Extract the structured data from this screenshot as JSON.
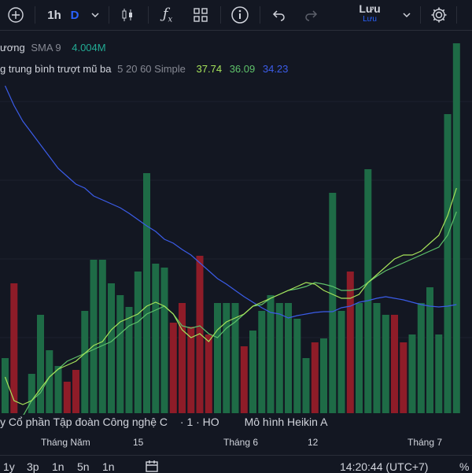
{
  "toolbar": {
    "interval": "1h",
    "interval_d": "D",
    "save_label": "Lưu",
    "save_sub": "Lưu",
    "icons": [
      "plus-icon",
      "chevron-down-icon",
      "candles-icon",
      "fx-icon",
      "grid-icon",
      "info-icon",
      "undo-icon",
      "redo-icon",
      "gear-icon"
    ]
  },
  "legend": {
    "volume_name": "ương",
    "volume_ma": "SMA 9",
    "volume_value": "4.004M",
    "ema_name": "g trung bình trượt mũ ba",
    "ema_params": "5 20 60 Simple",
    "ema_values": [
      "37.74",
      "36.09",
      "34.23"
    ],
    "colors": {
      "green": "#5ec26a",
      "lime": "#a6e35a",
      "blue": "#3b5ce8"
    }
  },
  "bottom": {
    "name_part1": "y Cổ phần Tập đoàn Công nghệ C",
    "name_part2": "· 1 · HO",
    "name_part3": "Mô hình Heikin A"
  },
  "xaxis": {
    "labels": [
      "Tháng Năm",
      "15",
      "Tháng 6",
      "12",
      "Tháng 7"
    ]
  },
  "footer": {
    "ranges": [
      "1y",
      "3p",
      "1n",
      "5n",
      "1n"
    ],
    "time": "14:20:44 (UTC+7)",
    "percent": "%"
  },
  "chart_data": {
    "type": "bar",
    "title": "",
    "bars": [
      {
        "v": 70,
        "c": "g"
      },
      {
        "v": 165,
        "c": "r"
      },
      {
        "v": 0,
        "c": "g"
      },
      {
        "v": 50,
        "c": "g"
      },
      {
        "v": 125,
        "c": "g"
      },
      {
        "v": 80,
        "c": "g"
      },
      {
        "v": 60,
        "c": "g"
      },
      {
        "v": 40,
        "c": "r"
      },
      {
        "v": 55,
        "c": "r"
      },
      {
        "v": 130,
        "c": "g"
      },
      {
        "v": 195,
        "c": "g"
      },
      {
        "v": 195,
        "c": "g"
      },
      {
        "v": 165,
        "c": "g"
      },
      {
        "v": 150,
        "c": "g"
      },
      {
        "v": 135,
        "c": "g"
      },
      {
        "v": 180,
        "c": "g"
      },
      {
        "v": 305,
        "c": "g"
      },
      {
        "v": 190,
        "c": "g"
      },
      {
        "v": 185,
        "c": "g"
      },
      {
        "v": 115,
        "c": "r"
      },
      {
        "v": 140,
        "c": "r"
      },
      {
        "v": 110,
        "c": "r"
      },
      {
        "v": 200,
        "c": "r"
      },
      {
        "v": 100,
        "c": "r"
      },
      {
        "v": 140,
        "c": "g"
      },
      {
        "v": 140,
        "c": "g"
      },
      {
        "v": 140,
        "c": "g"
      },
      {
        "v": 85,
        "c": "r"
      },
      {
        "v": 105,
        "c": "g"
      },
      {
        "v": 130,
        "c": "g"
      },
      {
        "v": 150,
        "c": "g"
      },
      {
        "v": 140,
        "c": "g"
      },
      {
        "v": 140,
        "c": "g"
      },
      {
        "v": 120,
        "c": "g"
      },
      {
        "v": 70,
        "c": "g"
      },
      {
        "v": 90,
        "c": "r"
      },
      {
        "v": 95,
        "c": "g"
      },
      {
        "v": 280,
        "c": "g"
      },
      {
        "v": 130,
        "c": "g"
      },
      {
        "v": 180,
        "c": "r"
      },
      {
        "v": 140,
        "c": "g"
      },
      {
        "v": 310,
        "c": "g"
      },
      {
        "v": 140,
        "c": "g"
      },
      {
        "v": 125,
        "c": "g"
      },
      {
        "v": 125,
        "c": "r"
      },
      {
        "v": 90,
        "c": "r"
      },
      {
        "v": 100,
        "c": "g"
      },
      {
        "v": 140,
        "c": "g"
      },
      {
        "v": 160,
        "c": "g"
      },
      {
        "v": 100,
        "c": "g"
      },
      {
        "v": 380,
        "c": "g"
      },
      {
        "v": 470,
        "c": "g"
      }
    ],
    "sma_short": [
      440,
      470,
      475,
      470,
      455,
      440,
      430,
      425,
      420,
      410,
      400,
      395,
      380,
      370,
      365,
      360,
      350,
      345,
      350,
      360,
      380,
      390,
      385,
      395,
      380,
      370,
      365,
      360,
      350,
      345,
      340,
      335,
      330,
      325,
      320,
      322,
      330,
      335,
      340,
      340,
      335,
      320,
      310,
      300,
      290,
      285,
      285,
      280,
      270,
      260,
      235,
      200
    ],
    "sma_mid": [
      505,
      500,
      490,
      470,
      460,
      440,
      430,
      420,
      415,
      410,
      405,
      400,
      395,
      385,
      375,
      370,
      360,
      355,
      350,
      360,
      375,
      378,
      375,
      385,
      390,
      378,
      370,
      360,
      350,
      348,
      340,
      335,
      330,
      328,
      325,
      320,
      322,
      325,
      330,
      330,
      328,
      320,
      312,
      305,
      300,
      295,
      290,
      285,
      280,
      275,
      260,
      230
    ],
    "sma_long": [
      70,
      95,
      115,
      130,
      145,
      160,
      175,
      185,
      195,
      200,
      210,
      215,
      220,
      225,
      232,
      240,
      248,
      255,
      265,
      270,
      278,
      285,
      295,
      305,
      315,
      322,
      330,
      338,
      345,
      352,
      358,
      360,
      365,
      362,
      360,
      358,
      357,
      357,
      352,
      350,
      345,
      343,
      340,
      338,
      340,
      342,
      345,
      348,
      350,
      351,
      350,
      348
    ]
  }
}
